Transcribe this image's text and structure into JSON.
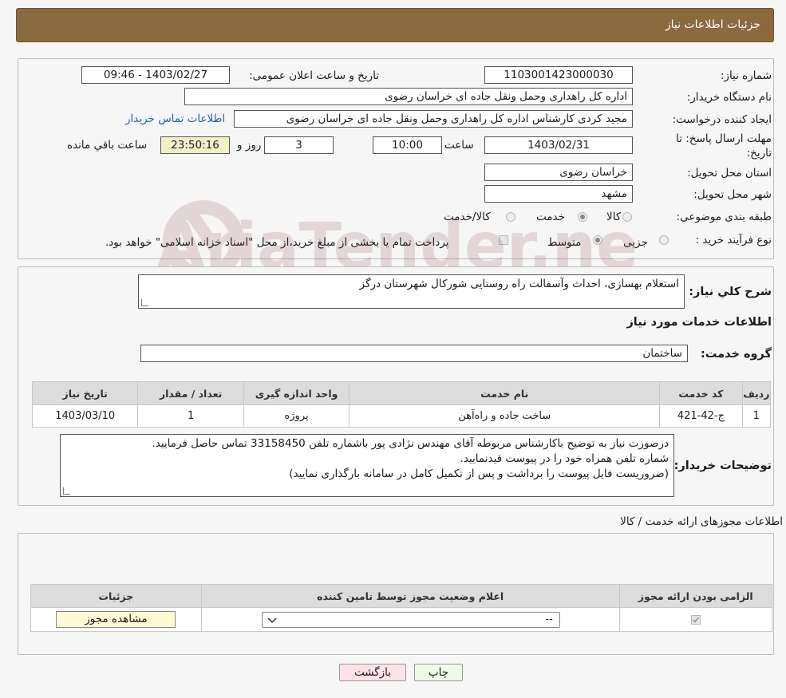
{
  "header": {
    "title": "جزئیات اطلاعات نیاز"
  },
  "form": {
    "need_number_label": "شماره نیاز:",
    "need_number": "1103001423000030",
    "announce_label": "تاریخ و ساعت اعلان عمومی:",
    "announce_value": "1403/02/27 - 09:46",
    "buyer_org_label": "نام دستگاه خریدار:",
    "buyer_org": "اداره کل راهداری وحمل ونقل جاده ای خراسان رضوی",
    "creator_label": "ایجاد کننده درخواست:",
    "creator": "مجید کردی کارشناس اداره کل راهداری وحمل ونقل جاده ای خراسان رضوی",
    "contact_link": "اطلاعات تماس خریدار",
    "deadline_label": "مهلت ارسال پاسخ: تا تاریخ:",
    "deadline_date": "1403/02/31",
    "time_label": "ساعت",
    "deadline_time": "10:00",
    "days_value": "3",
    "days_label": "روز و",
    "remaining_value": "23:50:16",
    "remaining_label": "ساعت باقي مانده",
    "province_label": "استان محل تحویل:",
    "province": "خراسان رضوی",
    "city_label": "شهر محل تحویل:",
    "city": "مشهد",
    "category_label": "طبقه بندی موضوعی:",
    "category_options": [
      "کالا",
      "خدمت",
      "کالا/خدمت"
    ],
    "category_selected": "خدمت",
    "purchase_label": "نوع فرآیند خرید :",
    "purchase_options": [
      "جزیی",
      "متوسط"
    ],
    "purchase_selected": "متوسط",
    "payment_note": "پرداخت تمام یا بخشی از مبلغ خرید،از محل \"اسناد خزانه اسلامی\" خواهد بود."
  },
  "details": {
    "summary_label": "شرح کلي نياز:",
    "summary": "استعلام بهسازی، احداث وآسفالت راه روستایی شورکال شهرستان درگز",
    "services_title": "اطلاعات خدمات مورد نیاز",
    "service_group_label": "گروه خدمت:",
    "service_group": "ساختمان",
    "table_headers": [
      "ردیف",
      "کد خدمت",
      "نام خدمت",
      "واحد اندازه گیری",
      "تعداد / مقدار",
      "تاریخ نیاز"
    ],
    "rows": [
      {
        "idx": "1",
        "code": "ج-42-421",
        "name": "ساخت جاده و راه‌آهن",
        "unit": "پروژه",
        "qty": "1",
        "date": "1403/03/10"
      }
    ],
    "buyer_notes_label": "توضیحات خریدار:",
    "buyer_notes": [
      "درصورت نیاز به توضیح باکارشناس مربوطه آقای مهندس نژادی پور باشماره تلفن 33158450 تماس حاصل فرمایید.",
      "شماره تلفن همراه خود را در پیوست قیدنمایید.",
      "(ضروریست فایل پیوست را برداشت و پس از تکمیل کامل در سامانه بارگذاری نمایید)"
    ]
  },
  "permits": {
    "title": "اطلاعات مجوزهای ارائه خدمت / کالا",
    "headers": [
      "الزامی بودن ارائه مجوز",
      "اعلام وضعیت مجوز توسط تامین کننده",
      "جزئیات"
    ],
    "select_value": "--",
    "view_button": "مشاهده مجوز"
  },
  "footer": {
    "print": "چاپ",
    "back": "بازگشت"
  },
  "watermark_text": "AriaTender.neT"
}
